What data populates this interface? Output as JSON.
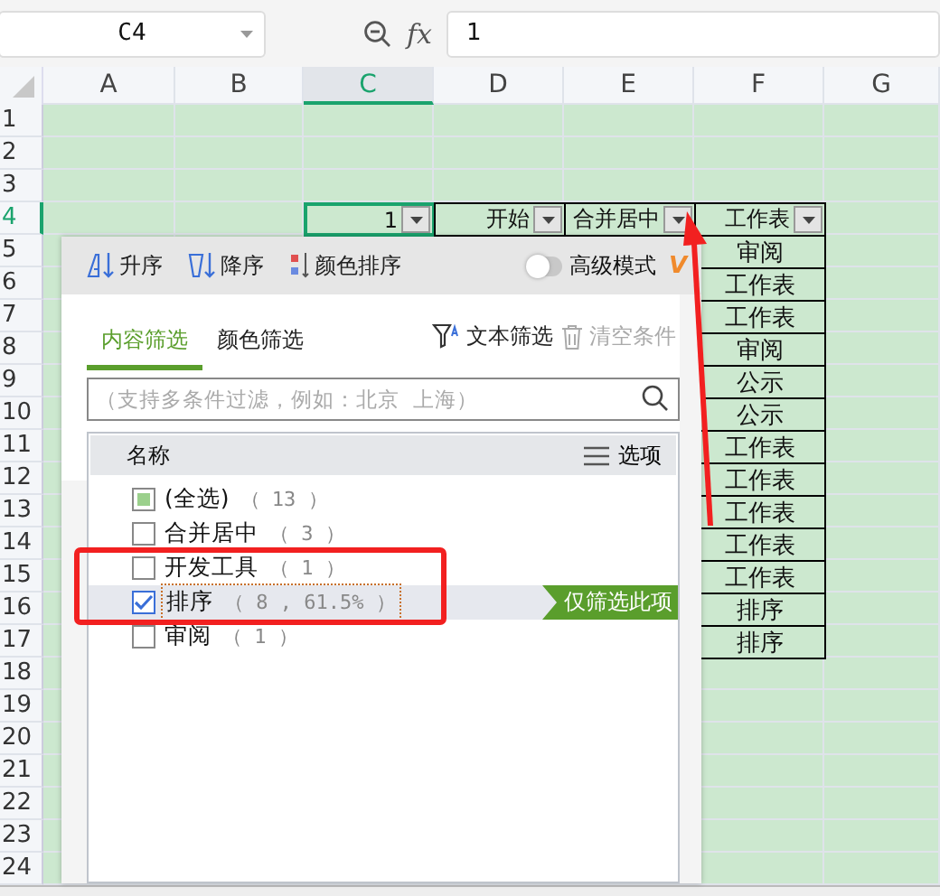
{
  "formula_bar": {
    "name_box": "C4",
    "fx": "fx",
    "formula": "1"
  },
  "sheet": {
    "columns": [
      {
        "label": "A",
        "selected": false
      },
      {
        "label": "B",
        "selected": false
      },
      {
        "label": "C",
        "selected": true
      },
      {
        "label": "D",
        "selected": false
      },
      {
        "label": "E",
        "selected": false
      },
      {
        "label": "F",
        "selected": false
      },
      {
        "label": "G",
        "selected": false
      }
    ],
    "rows": [
      {
        "header": "1",
        "selected": false
      },
      {
        "header": "2",
        "selected": false
      },
      {
        "header": "3",
        "selected": false
      },
      {
        "header": "4",
        "selected": true,
        "cells": [
          null,
          null,
          {
            "text": "1",
            "filter": true,
            "selected": true
          },
          {
            "text": "开始",
            "filter": true,
            "selected": false
          },
          {
            "text": "合并居中",
            "filter": true,
            "selected": false
          },
          {
            "text": "工作表",
            "filter": true,
            "selected": false
          }
        ]
      },
      {
        "header": "5",
        "selected": false,
        "cells": [
          null,
          null,
          null,
          null,
          null,
          {
            "text": "审阅",
            "filter": false,
            "selected": false
          }
        ]
      },
      {
        "header": "6",
        "selected": false,
        "cells": [
          null,
          null,
          null,
          null,
          null,
          {
            "text": "工作表",
            "filter": false,
            "selected": false
          }
        ]
      },
      {
        "header": "7",
        "selected": false,
        "cells": [
          null,
          null,
          null,
          null,
          null,
          {
            "text": "工作表",
            "filter": false,
            "selected": false
          }
        ]
      },
      {
        "header": "8",
        "selected": false,
        "cells": [
          null,
          null,
          null,
          null,
          null,
          {
            "text": "审阅",
            "filter": false,
            "selected": false
          }
        ]
      },
      {
        "header": "9",
        "selected": false,
        "cells": [
          null,
          null,
          null,
          null,
          null,
          {
            "text": "公示",
            "filter": false,
            "selected": false
          }
        ]
      },
      {
        "header": "10",
        "selected": false,
        "cells": [
          null,
          null,
          null,
          null,
          null,
          {
            "text": "公示",
            "filter": false,
            "selected": false
          }
        ]
      },
      {
        "header": "11",
        "selected": false,
        "cells": [
          null,
          null,
          null,
          null,
          null,
          {
            "text": "工作表",
            "filter": false,
            "selected": false
          }
        ]
      },
      {
        "header": "12",
        "selected": false,
        "cells": [
          null,
          null,
          null,
          null,
          null,
          {
            "text": "工作表",
            "filter": false,
            "selected": false
          }
        ]
      },
      {
        "header": "13",
        "selected": false,
        "cells": [
          null,
          null,
          null,
          null,
          null,
          {
            "text": "工作表",
            "filter": false,
            "selected": false
          }
        ]
      },
      {
        "header": "14",
        "selected": false,
        "cells": [
          null,
          null,
          null,
          null,
          null,
          {
            "text": "工作表",
            "filter": false,
            "selected": false
          }
        ]
      },
      {
        "header": "15",
        "selected": false,
        "cells": [
          null,
          null,
          null,
          null,
          null,
          {
            "text": "工作表",
            "filter": false,
            "selected": false
          }
        ]
      },
      {
        "header": "16",
        "selected": false,
        "cells": [
          null,
          null,
          null,
          null,
          null,
          {
            "text": "排序",
            "filter": false,
            "selected": false
          }
        ]
      },
      {
        "header": "17",
        "selected": false,
        "cells": [
          null,
          null,
          null,
          null,
          null,
          {
            "text": "排序",
            "filter": false,
            "selected": false
          }
        ]
      },
      {
        "header": "18",
        "selected": false
      },
      {
        "header": "19",
        "selected": false
      },
      {
        "header": "20",
        "selected": false
      },
      {
        "header": "21",
        "selected": false
      },
      {
        "header": "22",
        "selected": false
      },
      {
        "header": "23",
        "selected": false
      },
      {
        "header": "24",
        "selected": false
      }
    ]
  },
  "filter_popup": {
    "sort_buttons": [
      {
        "kind": "asc",
        "label": "升序"
      },
      {
        "kind": "desc",
        "label": "降序"
      },
      {
        "kind": "color",
        "label": "颜色排序"
      }
    ],
    "advanced_mode": {
      "label": "高级模式",
      "on": false,
      "badge": "V"
    },
    "tabs": [
      {
        "label": "内容筛选",
        "selected": true
      },
      {
        "label": "颜色筛选",
        "selected": false
      }
    ],
    "text_filter": "文本筛选",
    "clear": {
      "label": "清空条件",
      "disabled": true
    },
    "search": {
      "placeholder": "（支持多条件过滤，例如：北京  上海）"
    },
    "list_header": {
      "name": "名称",
      "options": "选项"
    },
    "items": [
      {
        "label": "(全选)",
        "count": "（ 13 ）",
        "checked": false,
        "partial": true,
        "selected": false
      },
      {
        "label": "合并居中",
        "count": "（ 3 ）",
        "checked": false,
        "partial": false,
        "selected": false
      },
      {
        "label": "开发工具",
        "count": "（ 1 ）",
        "checked": false,
        "partial": false,
        "selected": false
      },
      {
        "label": "排序",
        "count": "（ 8 , 61.5% ）",
        "checked": true,
        "partial": false,
        "selected": true,
        "action": "仅筛选此项"
      },
      {
        "label": "审阅",
        "count": "（ 1 ）",
        "checked": false,
        "partial": false,
        "selected": false
      }
    ]
  }
}
